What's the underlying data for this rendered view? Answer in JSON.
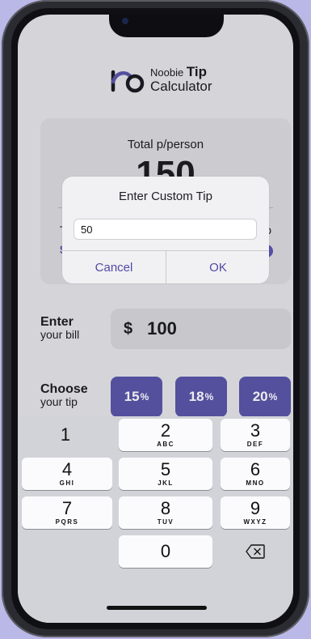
{
  "app": {
    "logo_small": "Noobie",
    "logo_bold": "Tip",
    "logo_second": "Calculator"
  },
  "total": {
    "label": "Total p/person",
    "value": "150",
    "left_peek": "T",
    "left_peek_2": "$",
    "right_peek": "o"
  },
  "bill": {
    "title": "Enter",
    "subtitle": "your bill",
    "currency": "$",
    "value": "100"
  },
  "tip": {
    "title": "Choose",
    "subtitle": "your tip",
    "options": [
      {
        "value": "15",
        "unit": "%"
      },
      {
        "value": "18",
        "unit": "%"
      },
      {
        "value": "20",
        "unit": "%"
      }
    ]
  },
  "dialog": {
    "title": "Enter Custom Tip",
    "input_value": "50",
    "cancel": "Cancel",
    "ok": "OK"
  },
  "keyboard": {
    "keys": [
      {
        "n": "1",
        "l": ""
      },
      {
        "n": "2",
        "l": "ABC"
      },
      {
        "n": "3",
        "l": "DEF"
      },
      {
        "n": "4",
        "l": "GHI"
      },
      {
        "n": "5",
        "l": "JKL"
      },
      {
        "n": "6",
        "l": "MNO"
      },
      {
        "n": "7",
        "l": "PQRS"
      },
      {
        "n": "8",
        "l": "TUV"
      },
      {
        "n": "9",
        "l": "WXYZ"
      },
      {
        "n": "0",
        "l": ""
      }
    ],
    "delete_icon": "backspace-icon"
  },
  "colors": {
    "accent": "#5b57ab",
    "background": "#b9b8e6"
  }
}
